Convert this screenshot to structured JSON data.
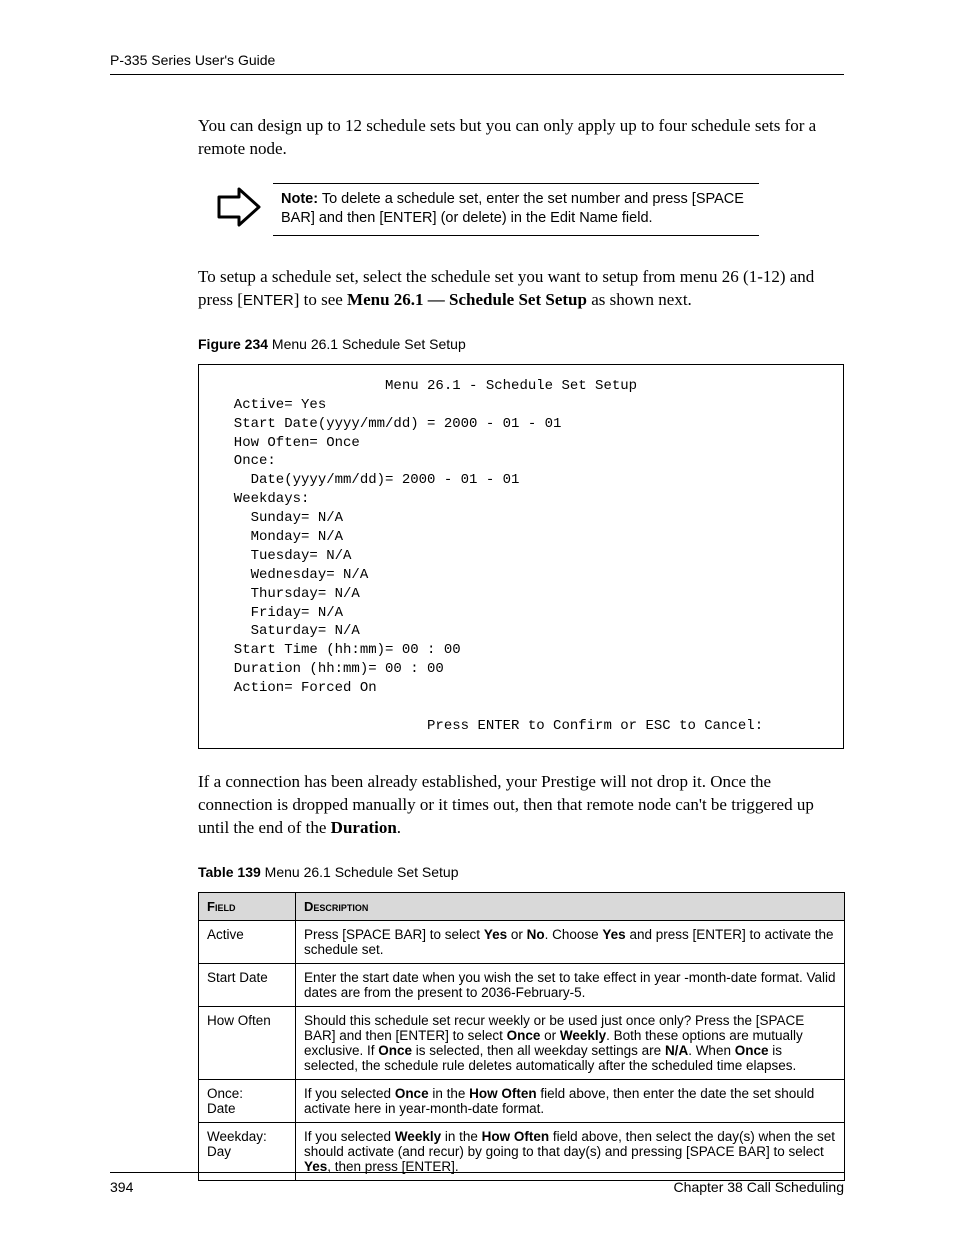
{
  "header": {
    "running_head": "P-335 Series User's Guide"
  },
  "intro": {
    "para1": "You can design up to 12 schedule sets but you can only apply up to four schedule sets for a remote node."
  },
  "note": {
    "label": "Note:",
    "text": " To delete a schedule set, enter the set number and press [SPACE BAR] and then [ENTER] (or delete) in the Edit Name field."
  },
  "setup_para": {
    "pre": " To setup a schedule set, select the schedule set you want to setup from menu 26 (1-12) and press [",
    "enter": "ENTER",
    "mid": "] to see ",
    "bold": "Menu 26.1 — Schedule Set Setup",
    "post": " as shown next."
  },
  "figure": {
    "num": "Figure 234",
    "title": "   Menu 26.1 Schedule Set Setup"
  },
  "terminal": "                    Menu 26.1 - Schedule Set Setup\n  Active= Yes\n  Start Date(yyyy/mm/dd) = 2000 - 01 - 01\n  How Often= Once\n  Once:\n    Date(yyyy/mm/dd)= 2000 - 01 - 01\n  Weekdays:\n    Sunday= N/A\n    Monday= N/A\n    Tuesday= N/A\n    Wednesday= N/A\n    Thursday= N/A\n    Friday= N/A\n    Saturday= N/A\n  Start Time (hh:mm)= 00 : 00\n  Duration (hh:mm)= 00 : 00\n  Action= Forced On\n\n                         Press ENTER to Confirm or ESC to Cancel:",
  "after_terminal": {
    "pre": "If a connection has been already established, your Prestige will not drop it. Once the connection is dropped manually or it times out, then that remote node can't be triggered up until the end of the ",
    "bold": "Duration",
    "post": "."
  },
  "table_caption": {
    "num": "Table 139",
    "title": "   Menu 26.1 Schedule Set Setup"
  },
  "table": {
    "headers": {
      "field": "Field",
      "description": "Description"
    },
    "rows": [
      {
        "field": "Active",
        "html": "Press [SPACE BAR] to select <b>Yes</b> or <b>No</b>. Choose <b>Yes</b> and press [ENTER] to activate the schedule set."
      },
      {
        "field": "Start Date",
        "html": "Enter the start date when you wish the set to take effect in year -month-date format. Valid dates are from the present to 2036-February-5."
      },
      {
        "field": "How Often",
        "html": "Should this schedule set recur weekly or be used just once only? Press the [SPACE BAR] and then [ENTER] to select <b>Once</b> or <b>Weekly</b>. Both these options are mutually exclusive.  If <b>Once</b> is selected, then all weekday settings are <b>N/A</b>. When <b>Once</b> is selected, the schedule rule deletes automatically after the scheduled time elapses."
      },
      {
        "field": "Once:\nDate",
        "html": "If you selected <b>Once</b> in the <b>How Often</b> field above, then enter the date the set should activate here in year-month-date format."
      },
      {
        "field": "Weekday:\nDay",
        "html": "If you selected <b>Weekly</b> in the <b>How Often</b> field above, then select the day(s) when the set should activate (and recur) by going to that day(s) and pressing [SPACE BAR] to select <b>Yes</b>, then press [ENTER]."
      }
    ]
  },
  "footer": {
    "page_number": "394",
    "chapter": "Chapter 38 Call Scheduling"
  }
}
